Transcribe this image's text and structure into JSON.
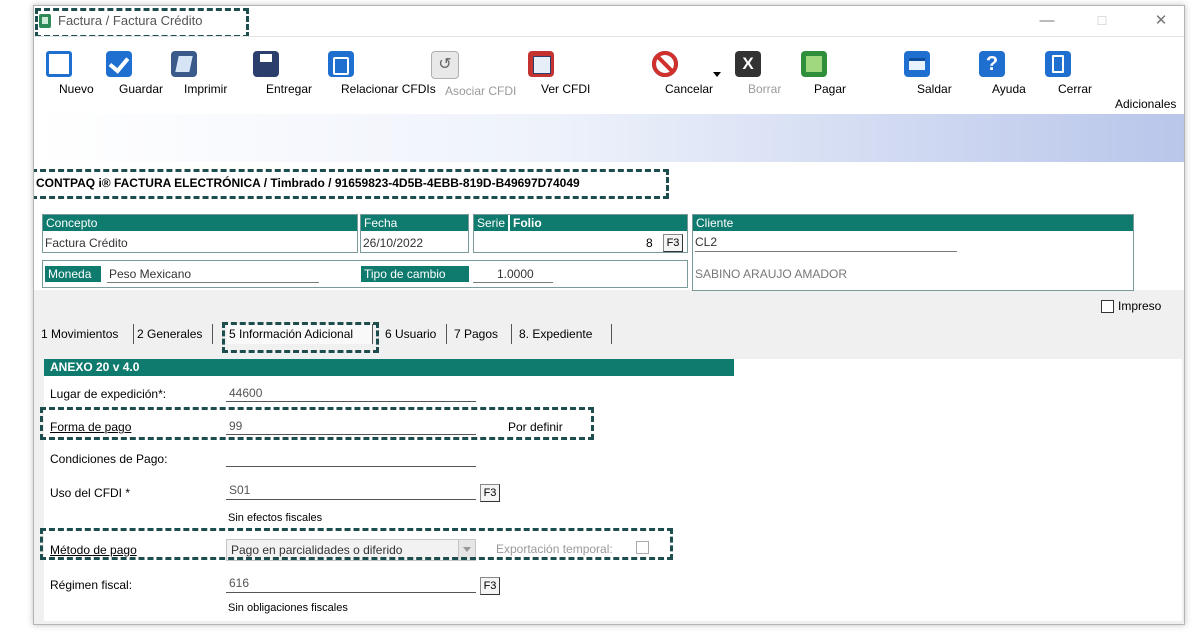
{
  "window": {
    "title": "Factura / Factura Crédito",
    "controls": {
      "minimize": "—",
      "maximize": "☐",
      "close": "✕"
    }
  },
  "toolbar": {
    "buttons": [
      {
        "label": "Nuevo",
        "icon": "new-document-icon"
      },
      {
        "label": "Guardar",
        "icon": "checkmark-icon"
      },
      {
        "label": "Imprimir",
        "icon": "print-icon"
      },
      {
        "label": "Entregar",
        "icon": "save-disk-icon"
      },
      {
        "label": "Relacionar CFDIs",
        "icon": "relate-documents-icon"
      },
      {
        "label": "Asociar CFDI",
        "icon": "associate-icon",
        "disabled": true
      },
      {
        "label": "Ver CFDI",
        "icon": "view-cfdi-icon"
      },
      {
        "label": "Cancelar",
        "icon": "cancel-icon"
      },
      {
        "label": "Borrar",
        "icon": "delete-x-icon",
        "disabled": true
      },
      {
        "label": "Pagar",
        "icon": "pay-icon"
      },
      {
        "label": "Saldar",
        "icon": "settle-icon"
      },
      {
        "label": "Ayuda",
        "icon": "help-icon"
      },
      {
        "label": "Cerrar",
        "icon": "exit-icon"
      },
      {
        "label": "Adicionales",
        "icon": ""
      }
    ]
  },
  "header": {
    "text": "CONTPAQ i® FACTURA ELECTRÓNICA / Timbrado / 91659823-4D5B-4EBB-819D-B49697D74049"
  },
  "document": {
    "concepto_label": "Concepto",
    "concepto_value": "Factura Crédito",
    "fecha_label": "Fecha",
    "fecha_value": "26/10/2022",
    "serie_label": "Serie",
    "folio_label": "Folio",
    "folio_value": "8",
    "f3_label": "F3",
    "cliente_label": "Cliente",
    "cliente_code": "CL2",
    "cliente_name": "SABINO ARAUJO AMADOR",
    "moneda_label": "Moneda",
    "moneda_value": "Peso Mexicano",
    "tipo_cambio_label": "Tipo de cambio",
    "tipo_cambio_value": "1.0000",
    "impreso_label": "Impreso"
  },
  "tabs": [
    {
      "label": "1 Movimientos"
    },
    {
      "label": "2 Generales"
    },
    {
      "label": "5 Información Adicional",
      "active": true
    },
    {
      "label": "6 Usuario"
    },
    {
      "label": "7 Pagos"
    },
    {
      "label": "8. Expediente"
    }
  ],
  "anexo": {
    "title": "ANEXO 20 v 4.0",
    "lugar_label": "Lugar de expedición*:",
    "lugar_value": "44600",
    "forma_label": "Forma de pago",
    "forma_value": "99",
    "forma_desc": "Por definir",
    "condiciones_label": "Condiciones de Pago:",
    "condiciones_value": "",
    "uso_label": "Uso del CFDI *",
    "uso_value": "S01",
    "uso_desc": "Sin efectos fiscales",
    "metodo_label": "Método de pago",
    "metodo_value": "Pago en parcialidades o diferido",
    "exportacion_label": "Exportación temporal:",
    "regimen_label": "Régimen fiscal:",
    "regimen_value": "616",
    "regimen_desc": "Sin obligaciones fiscales",
    "f3_label": "F3"
  },
  "colors": {
    "header_teal": "#0f7a6e",
    "highlight_dash": "#1e4d4d",
    "toolbar_blue": "#1f6fd0"
  }
}
